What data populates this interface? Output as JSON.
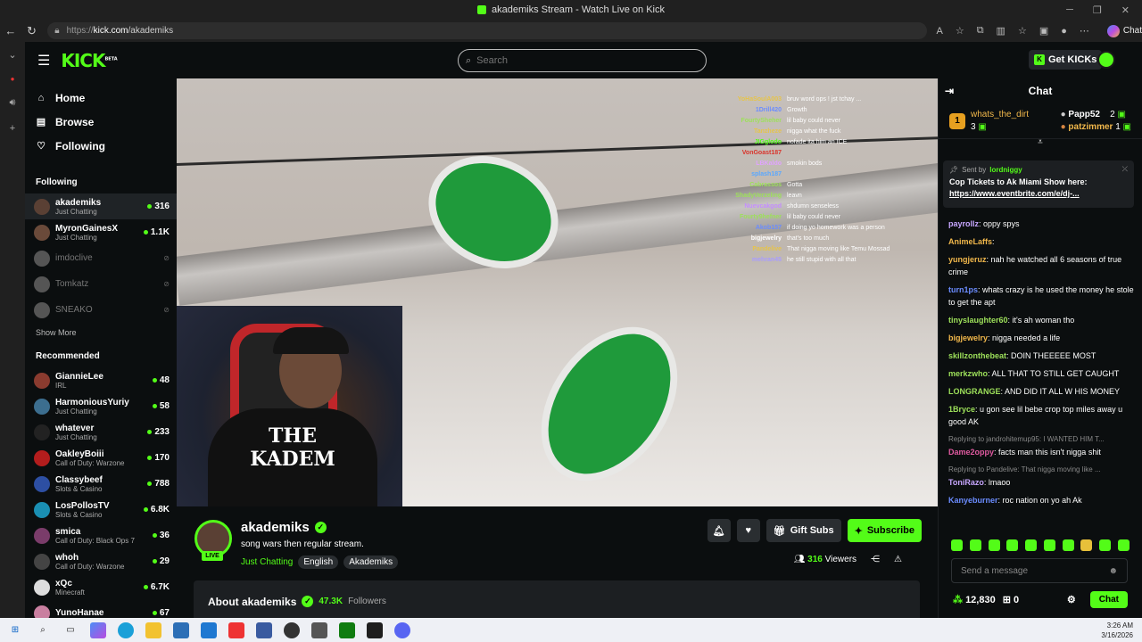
{
  "browser": {
    "window_title": "akademiks Stream - Watch Live on Kick",
    "url_prefix": "https://",
    "url_host": "kick.com",
    "url_path": "/akademiks",
    "chat_label": "Chat"
  },
  "header": {
    "logo": "KICK",
    "logo_beta": "BETA",
    "search_placeholder": "Search",
    "get_kicks": "Get KICKs"
  },
  "sidebar": {
    "nav": [
      {
        "label": "Home",
        "icon": "home-icon"
      },
      {
        "label": "Browse",
        "icon": "browse-icon"
      },
      {
        "label": "Following",
        "icon": "heart-icon"
      }
    ],
    "following_heading": "Following",
    "following": [
      {
        "name": "akademiks",
        "category": "Just Chatting",
        "viewers": "316",
        "live": true
      },
      {
        "name": "MyronGainesX",
        "category": "Just Chatting",
        "viewers": "1.1K",
        "live": true
      },
      {
        "name": "imdoclive",
        "live": false
      },
      {
        "name": "Tomkatz",
        "live": false
      },
      {
        "name": "SNEAKO",
        "live": false
      }
    ],
    "show_more": "Show More",
    "recommended_heading": "Recommended",
    "recommended": [
      {
        "name": "GiannieLee",
        "category": "IRL",
        "viewers": "48",
        "color": "#8a3b2f"
      },
      {
        "name": "HarmoniousYuriy",
        "category": "Just Chatting",
        "viewers": "58",
        "color": "#3c6e8f"
      },
      {
        "name": "whatever",
        "category": "Just Chatting",
        "viewers": "233",
        "color": "#222222"
      },
      {
        "name": "OakleyBoiii",
        "category": "Call of Duty: Warzone",
        "viewers": "170",
        "color": "#b31d1d"
      },
      {
        "name": "Classybeef",
        "category": "Slots & Casino",
        "viewers": "788",
        "color": "#2d4fa3"
      },
      {
        "name": "LosPollosTV",
        "category": "Slots & Casino",
        "viewers": "6.8K",
        "color": "#1a8fb3"
      },
      {
        "name": "smica",
        "category": "Call of Duty: Black Ops 7",
        "viewers": "36",
        "color": "#7a3c6a"
      },
      {
        "name": "whoh",
        "category": "Call of Duty: Warzone",
        "viewers": "29",
        "color": "#444444"
      },
      {
        "name": "xQc",
        "category": "Minecraft",
        "viewers": "6.7K",
        "color": "#dddddd"
      },
      {
        "name": "YunoHanae",
        "category": "",
        "viewers": "67",
        "color": "#c97fa0"
      }
    ]
  },
  "video_overlay_chat": [
    {
      "user": "YoHaSoulA003",
      "text": "bruv word ops ! jst tchay ... ",
      "color": "#e6c44a"
    },
    {
      "user": "1Drill420",
      "text": "Growth",
      "color": "#6b8cff"
    },
    {
      "user": "FourtySheher",
      "text": "lil baby could never",
      "color": "#9de05a"
    },
    {
      "user": "Tanzheze",
      "text": "nigga what the fuck",
      "color": "#e6c44a"
    },
    {
      "user": "JIGglodo",
      "text": "nofade ita him an ICE",
      "color": "#53fc18"
    },
    {
      "user": "VonGoast187",
      "text": "",
      "color": "#d9342b"
    },
    {
      "user": "LBKaldo",
      "text": "smokin bods",
      "color": "#e0a3ff"
    },
    {
      "user": "splash187",
      "text": "",
      "color": "#5aa8ff"
    },
    {
      "user": "Cabrassos",
      "text": "Gotta",
      "color": "#9de05a"
    },
    {
      "user": "ShadyVerzeling",
      "text": "leavn",
      "color": "#9de05a"
    },
    {
      "user": "Nuevcakgod",
      "text": "shdumn senseless",
      "color": "#c48cff"
    },
    {
      "user": "Fourty9hefner",
      "text": "lil baby could never",
      "color": "#9de05a"
    },
    {
      "user": "Akob157",
      "text": "if doing yo homework was a person",
      "color": "#6b8cff"
    },
    {
      "user": "bigjewelry",
      "text": "that's too much",
      "color": "#ffffff"
    },
    {
      "user": "Pandelive",
      "text": "That nigga moving like Temu Mossad",
      "color": "#e6c44a"
    },
    {
      "user": "mehran45",
      "text": "he still stupid with all that",
      "color": "#a89cff"
    }
  ],
  "stream": {
    "name": "akademiks",
    "live_badge": "LIVE",
    "title": "song wars then regular stream.",
    "category": "Just Chatting",
    "tags": [
      "English",
      "Akademiks"
    ],
    "gift_subs": "Gift Subs",
    "subscribe": "Subscribe",
    "viewers": "316",
    "viewers_label": "Viewers"
  },
  "about": {
    "title": "About akademiks",
    "followers": "47.3K",
    "followers_label": "Followers"
  },
  "chat": {
    "heading": "Chat",
    "leaders": {
      "first_rank": "1",
      "first_name": "whats_the_dirt",
      "first_count": "3",
      "second_name": "Papp52",
      "second_count": "2",
      "third_name": "patzimmer",
      "third_count": "1"
    },
    "pinned": {
      "sent_by": "Sent by",
      "user": "lordniggy",
      "message": "Cop Tickets to Ak Miami Show here:",
      "link": "https://www.eventbrite.com/e/dj-..."
    },
    "messages": [
      {
        "user": "payrollz",
        "text": "oppy spys",
        "color": "#c7a6ff",
        "reply": ""
      },
      {
        "user": "AnimeLaffs",
        "text": "",
        "color": "#f2b84b",
        "reply": ""
      },
      {
        "user": "yungjeruz",
        "text": "nah he watched all 6 seasons of true crime",
        "color": "#f2b84b",
        "reply": ""
      },
      {
        "user": "turn1ps",
        "text": "whats crazy is he used the money he stole to get the apt",
        "color": "#6b8cff",
        "reply": ""
      },
      {
        "user": "tinyslaughter60",
        "text": "it's ah woman tho",
        "color": "#9de05a",
        "reply": ""
      },
      {
        "user": "bigjewelry",
        "text": "nigga needed a life",
        "color": "#f2b84b",
        "reply": ""
      },
      {
        "user": "skillzonthebeat",
        "text": "DOIN THEEEEE MOST",
        "color": "#9de05a",
        "reply": ""
      },
      {
        "user": "merkzwho",
        "text": "ALL THAT TO STILL GET CAUGHT",
        "color": "#9de05a",
        "reply": ""
      },
      {
        "user": "LONGRANGE",
        "text": "AND DID IT ALL W HIS MONEY",
        "color": "#9de05a",
        "reply": ""
      },
      {
        "user": "1Bryce",
        "text": "u gon see lil bebe crop top miles away   u good AK",
        "color": "#9de05a",
        "reply": ""
      },
      {
        "user": "Dame2oppy",
        "text": "facts man this isn't nigga shit",
        "color": "#e05aa0",
        "reply": "Replying to jandrohitemup95: I WANTED HIM T..."
      },
      {
        "user": "ToniRazo",
        "text": "lmaoo",
        "color": "#c7a6ff",
        "reply": "Replying to Pandelive: That nigga moving like ..."
      },
      {
        "user": "Kanyeburner",
        "text": "roc nation on yo ah Ak",
        "color": "#6b8cff",
        "reply": ""
      }
    ],
    "input_placeholder": "Send a message",
    "kicks_balance": "12,830",
    "gifts_count": "0",
    "send_label": "Chat"
  },
  "taskbar": {
    "time": "3:26 AM",
    "date": "3/16/2026"
  }
}
